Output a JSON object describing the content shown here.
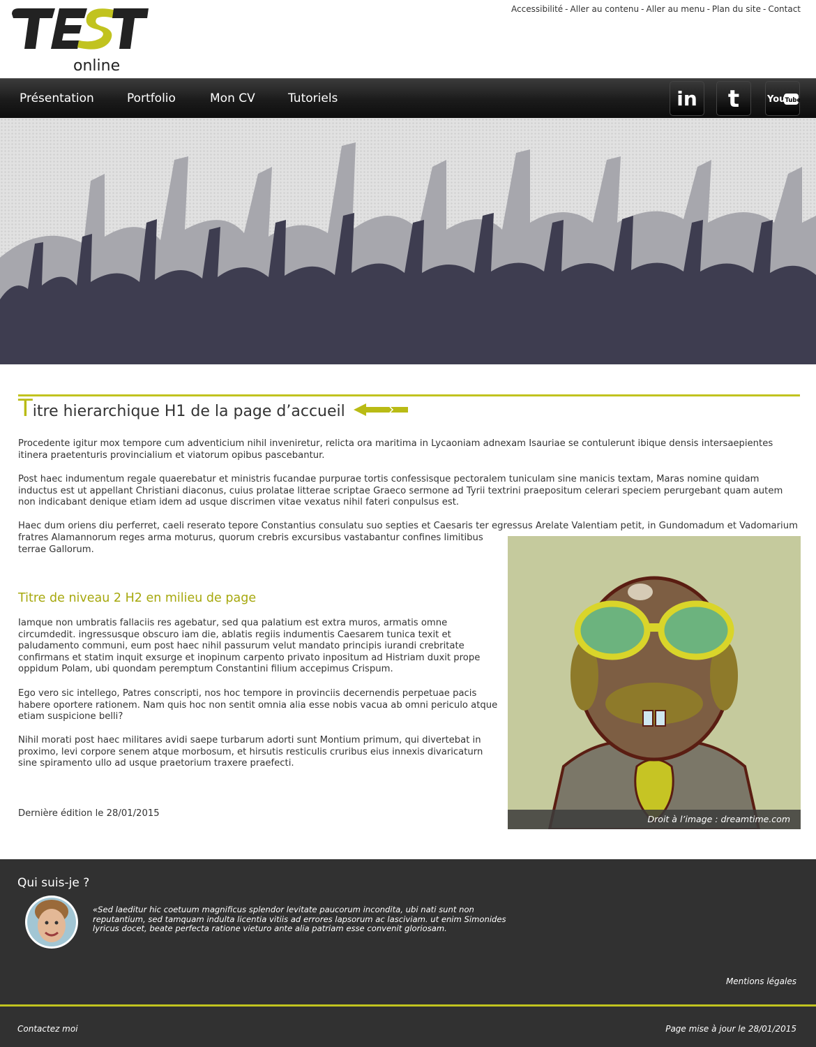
{
  "logo": {
    "big": "TEST",
    "small": "online"
  },
  "toplinks": [
    "Accessibilité",
    "Aller au contenu",
    "Aller au menu",
    "Plan du site",
    "Contact"
  ],
  "nav": {
    "items": [
      "Présentation",
      "Portfolio",
      "Mon CV",
      "Tutoriels"
    ]
  },
  "social": {
    "linkedin": "in",
    "twitter": "t",
    "youtube_a": "You",
    "youtube_b": "Tube"
  },
  "main": {
    "h1_cap": "T",
    "h1_rest": "itre hierarchique H1 de la page d’accueil",
    "p1": "Procedente igitur mox tempore cum adventicium nihil inveniretur, relicta ora maritima in Lycaoniam adnexam Isauriae se contulerunt ibique densis intersaepientes itinera praetenturis provincialium et viatorum opibus pascebantur.",
    "p2": "Post haec indumentum regale quaerebatur et ministris fucandae purpurae tortis confessisque pectoralem tuniculam sine manicis textam, Maras nomine quidam inductus est ut appellant Christiani diaconus, cuius prolatae litterae scriptae Graeco sermone ad Tyrii textrini praepositum celerari speciem perurgebant quam autem non indicabant denique etiam idem ad usque discrimen vitae vexatus nihil fateri conpulsus est.",
    "p3a": "Haec dum oriens diu perferret, caeli reserato tepore Constantius consulatu suo septies et Caesaris ter egressus Arelate Valentiam petit, in Gundomadum et Vadomarium",
    "p3b": "fratres Alamannorum reges arma moturus, quorum crebris excursibus vastabantur confines limitibus terrae Gallorum.",
    "h2": "Titre de niveau 2 H2 en milieu de page",
    "p4": "Iamque non umbratis fallaciis res agebatur, sed qua palatium est extra muros, armatis omne circumdedit. ingressusque obscuro iam die, ablatis regiis indumentis Caesarem tunica texit et paludamento communi, eum post haec nihil passurum velut mandato principis iurandi crebritate confirmans et statim inquit exsurge et inopinum carpento privato inpositum ad Histriam duxit prope oppidum Polam, ubi quondam peremptum Constantini filium accepimus Crispum.",
    "p5": "Ego vero sic intellego, Patres conscripti, nos hoc tempore in provinciis decernendis perpetuae pacis habere oportere rationem. Nam quis hoc non sentit omnia alia esse nobis vacua ab omni periculo atque etiam suspicione belli?",
    "p6": "Nihil morati post haec militares avidi saepe turbarum adorti sunt Montium primum, qui divertebat in proximo, levi corpore senem atque morbosum, et hirsutis resticulis cruribus eius innexis divaricaturn sine spiramento ullo ad usque praetorium traxere praefecti.",
    "last_edit": "Dernière édition le 28/01/2015",
    "caption": "Droit à l’image : dreamtime.com"
  },
  "footer": {
    "title": "Qui suis-je ?",
    "quote": "«Sed laeditur hic coetuum magnificus splendor levitate paucorum incondita, ubi nati sunt non reputantium, sed tamquam indulta licentia vitiis ad errores lapsorum ac lasciviam. ut enim Simonides lyricus docet, beate perfecta ratione vieturo ante alia patriam esse convenit gloriosam.",
    "mentions": "Mentions légales",
    "contact": "Contactez moi",
    "updated": "Page mise à jour le 28/01/2015"
  },
  "colors": {
    "accent": "#c1c31f",
    "h2": "#a6a80d",
    "footer_bg": "#313131",
    "nav_bg": "#1b1b1b"
  }
}
